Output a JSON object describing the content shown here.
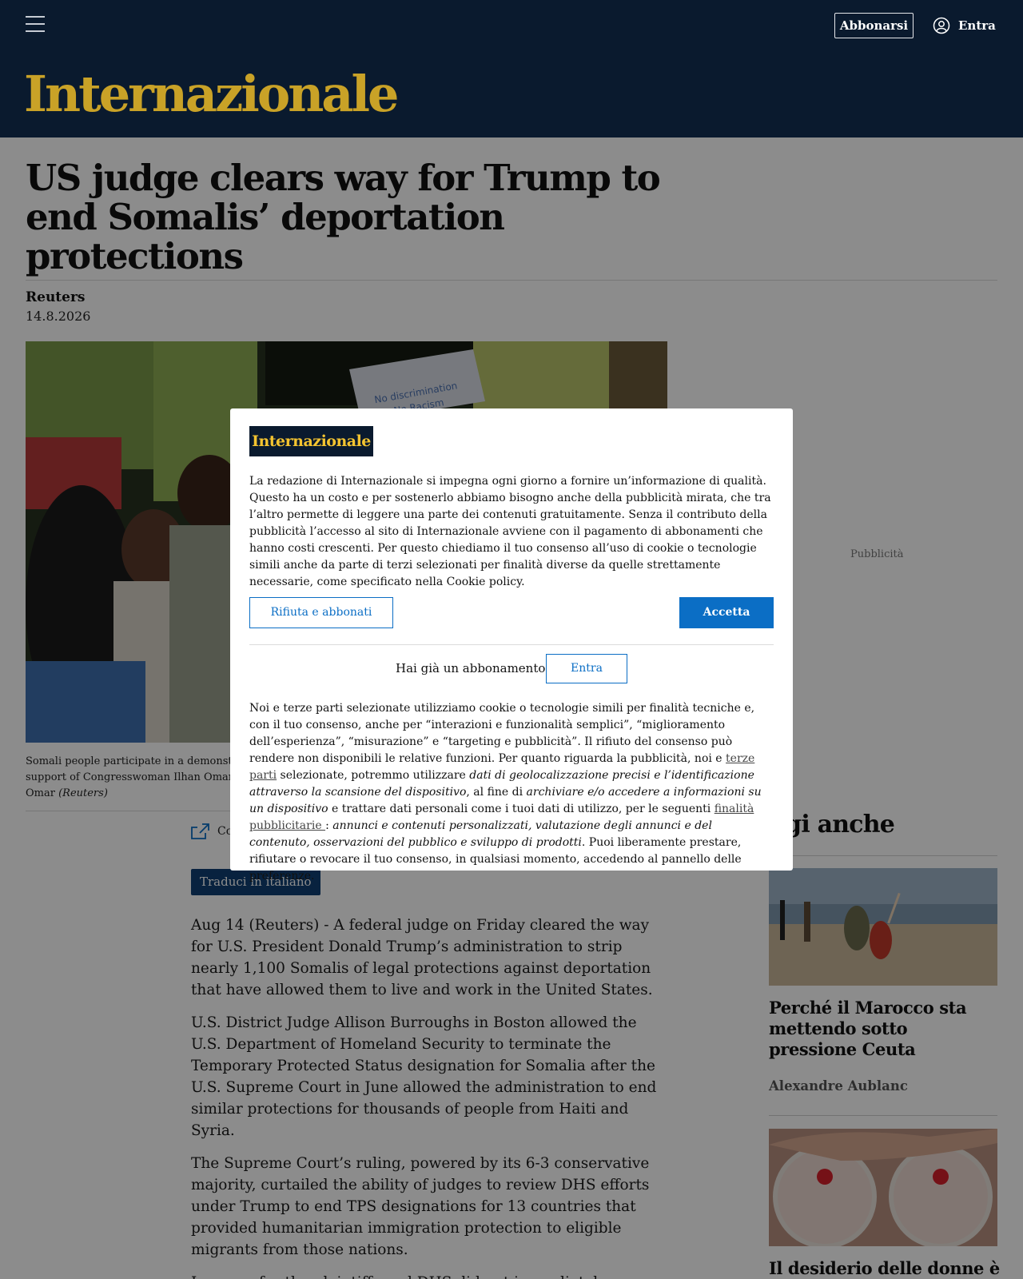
{
  "header": {
    "subscribe_label": "Abbonarsi",
    "login_label": "Entra",
    "logo_text": "Internazionale",
    "bg_color": "#0a1a2e",
    "logo_color": "#c9a227"
  },
  "article": {
    "title": "US judge clears way for Trump to end Somalis’ deportation protections",
    "author": "Reuters",
    "date": "14.8.2026",
    "sign_line1": "No discrimination",
    "sign_line2": "No Racism",
    "caption_line1": "Somali people participate in a demonstratio",
    "caption_line2": "support of Congresswoman Ilhan Omar (D",
    "caption_line3": "Omar",
    "caption_credit": "(Reuters)",
    "share_label": "Co",
    "translate_label": "Traduci in italiano",
    "paragraphs": [
      "Aug 14 (Reuters) - A federal judge on Friday cleared the way for U.S. President Donald Trump’s administration to strip nearly 1,100 Somalis of legal protections against deportation that have allowed them to live and work in the United States.",
      "U.S. District Judge Allison Burroughs in Boston allowed the U.S. Department of Homeland Security to terminate the Temporary Protected Status designation for Somalia after the U.S. Supreme Court in June allowed the administration to end similar protections for thousands of people from Haiti and Syria.",
      "The Supreme Court’s ruling, powered by its 6-3 conservative majority, curtailed the ability of judges to review DHS efforts under Trump to end TPS designations for 13 countries that provided humanitarian immigration protection to eligible migrants from those nations.",
      "Lawyers for the plaintiffs and DHS did not immediately respond to requests for comment."
    ]
  },
  "sidebar": {
    "ad_label": "Pubblicità",
    "section_title": "ggi anche",
    "items": [
      {
        "title": "Perché il Marocco sta mettendo sotto pressione Ceuta",
        "author": "Alexandre Aublanc"
      },
      {
        "title": "Il desiderio delle donne è"
      }
    ]
  },
  "consent": {
    "logo_text": "Internazionale",
    "intro": "La redazione di Internazionale si impegna ogni giorno a fornire un’informazione di qualità. Questo ha un costo e per sostenerlo abbiamo bisogno anche della pubblicità mirata, che tra l’altro permette di leggere una parte dei contenuti gratuitamente. Senza il contributo della pubblicità l’accesso al sito di Internazionale avviene con il pagamento di abbonamenti che hanno costi crescenti. Per questo chiediamo il tuo consenso all’uso di cookie o tecnologie simili anche da parte di terzi selezionati per finalità diverse da quelle strettamente necessarie, come specificato nella Cookie policy.",
    "reject_label": "Rifiuta e abbonati",
    "accept_label": "Accetta",
    "have_sub_label": "Hai già un abbonamento?",
    "login_label": "Entra",
    "legal_1": "Noi e terze parti selezionate utilizziamo cookie o tecnologie simili per finalità tecniche e, con il tuo consenso, anche per “interazioni e funzionalità semplici”, “miglioramento dell’esperienza”, “misurazione” e “targeting e pubblicità”. Il rifiuto del consenso può rendere non disponibili le relative funzioni. Per quanto riguarda la pubblicità, noi e ",
    "legal_link1": "terze parti",
    "legal_2": " selezionate, potremmo utilizzare ",
    "legal_it1": "dati di geolocalizzazione precisi e l’identificazione attraverso la scansione del dispositivo",
    "legal_3": ", al fine di ",
    "legal_it2": "archiviare e/o accedere a informazioni su un dispositivo",
    "legal_4": " e trattare dati personali come i tuoi dati di utilizzo, per le seguenti ",
    "legal_link2": "finalità pubblicitarie ",
    "legal_5": ": ",
    "legal_it3": "annunci e contenuti personalizzati, valutazione degli annunci e del contenuto, osservazioni del pubblico e sviluppo di prodotti",
    "legal_6": ". Puoi liberamente prestare, rifiutare o revocare il tuo consenso, in qualsiasi momento, accedendo al pannello delle preferenze.",
    "accent_color": "#0b6ec5"
  }
}
